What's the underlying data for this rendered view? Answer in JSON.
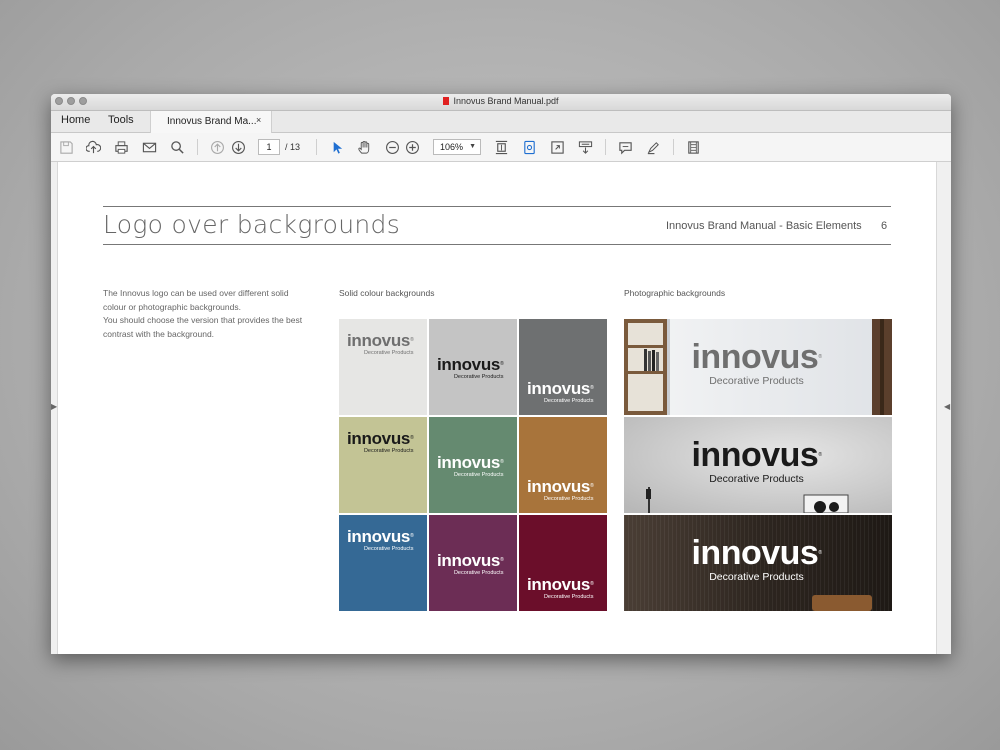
{
  "window": {
    "title": "Innovus Brand Manual.pdf"
  },
  "tabs": {
    "home": "Home",
    "tools": "Tools",
    "document": "Innovus Brand Ma...",
    "close": "×"
  },
  "toolbar": {
    "page_current": "1",
    "page_total": "/ 13",
    "zoom": "106%",
    "icons": [
      "save-icon",
      "upload-icon",
      "print-icon",
      "mail-icon",
      "search-icon",
      "page-up-icon",
      "page-down-icon",
      "select-pointer-icon",
      "hand-icon",
      "zoom-out-icon",
      "zoom-in-icon",
      "fit-page-icon",
      "scroll-mode-icon",
      "full-screen-icon",
      "read-mode-icon",
      "comment-icon",
      "highlight-icon",
      "filmstrip-icon"
    ]
  },
  "page": {
    "title": "Logo over backgrounds",
    "header_right": "Innovus Brand Manual - Basic Elements",
    "page_number": "6",
    "body_text": "The Innovus logo can be used over different solid colour or photographic backgrounds.\nYou should choose the version that provides the best contrast with the background.",
    "solid_title": "Solid colour backgrounds",
    "photo_title": "Photographic backgrounds"
  },
  "logo": {
    "wordmark": "innovus",
    "registered": "®",
    "tagline": "Decorative Products"
  },
  "swatches": [
    {
      "bg": "#e6e6e4",
      "ink": "#6f6f6f"
    },
    {
      "bg": "#c4c4c4",
      "ink": "#1a1a1a"
    },
    {
      "bg": "#6e7071",
      "ink": "#ffffff"
    },
    {
      "bg": "#c3c495",
      "ink": "#1a1a1a"
    },
    {
      "bg": "#658a70",
      "ink": "#ffffff"
    },
    {
      "bg": "#a8743b",
      "ink": "#ffffff"
    },
    {
      "bg": "#356995",
      "ink": "#ffffff"
    },
    {
      "bg": "#6c2d55",
      "ink": "#ffffff"
    },
    {
      "bg": "#6b0e2a",
      "ink": "#ffffff"
    }
  ],
  "photo_inks": [
    "#6f6f6f",
    "#1a1a1a",
    "#ffffff"
  ]
}
